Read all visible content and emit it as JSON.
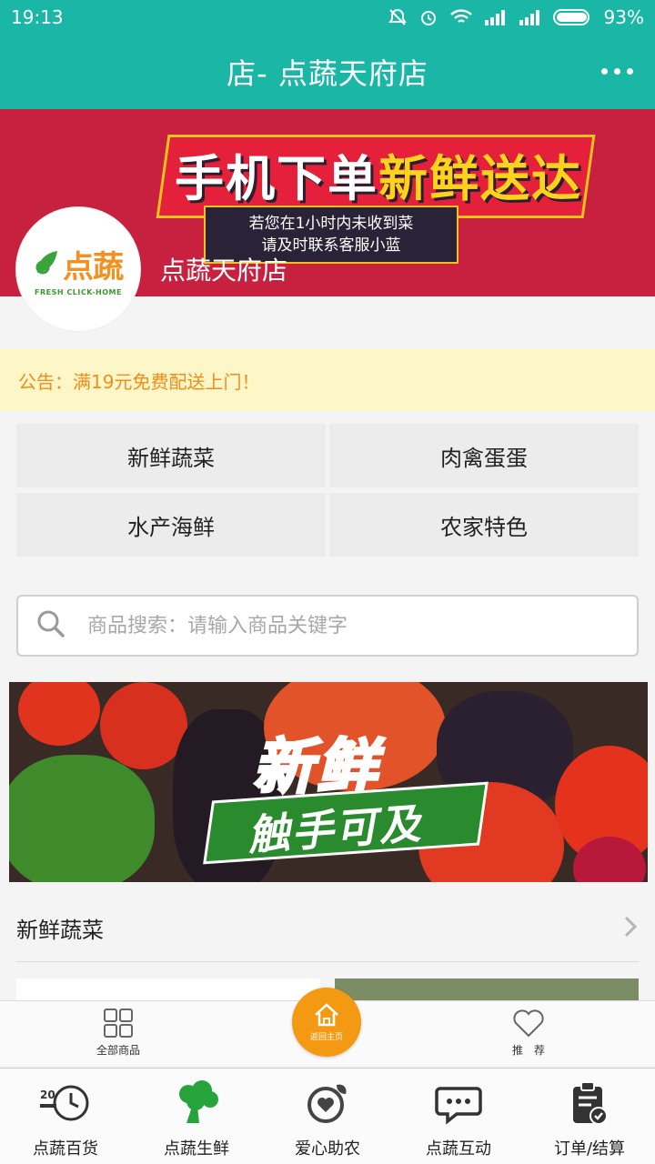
{
  "status": {
    "time": "19:13",
    "battery": "93%"
  },
  "titlebar": {
    "title": "店- 点蔬天府店"
  },
  "banner": {
    "headline_white_1": "手机下单",
    "headline_yellow": "新鲜送达",
    "sub_line1": "若您在1小时内未收到菜",
    "sub_line2": "请及时联系客服小蓝",
    "logo_text": "点蔬",
    "logo_sub": "FRESH CLICK-HOME",
    "store_name": "点蔬天府店"
  },
  "notice": {
    "text": "公告：满19元免费配送上门！"
  },
  "categories": [
    "新鲜蔬菜",
    "肉禽蛋蛋",
    "水产海鲜",
    "农家特色"
  ],
  "search": {
    "placeholder": "商品搜索：请输入商品关键字"
  },
  "fresh_banner": {
    "title": "新鲜",
    "subtitle": "触手可及"
  },
  "section": {
    "label": "新鲜蔬菜"
  },
  "shopbar": {
    "all": "全部商品",
    "home": "返回主页",
    "recommend": "推　荐"
  },
  "bottom_nav": [
    "点蔬百货",
    "点蔬生鲜",
    "爱心助农",
    "点蔬互动",
    "订单/结算"
  ],
  "colors": {
    "teal": "#1bb7a6",
    "crimson": "#c8203f",
    "orange": "#f49a12",
    "notice_bg": "#fdf7c7",
    "notice_text": "#f08d1c"
  }
}
